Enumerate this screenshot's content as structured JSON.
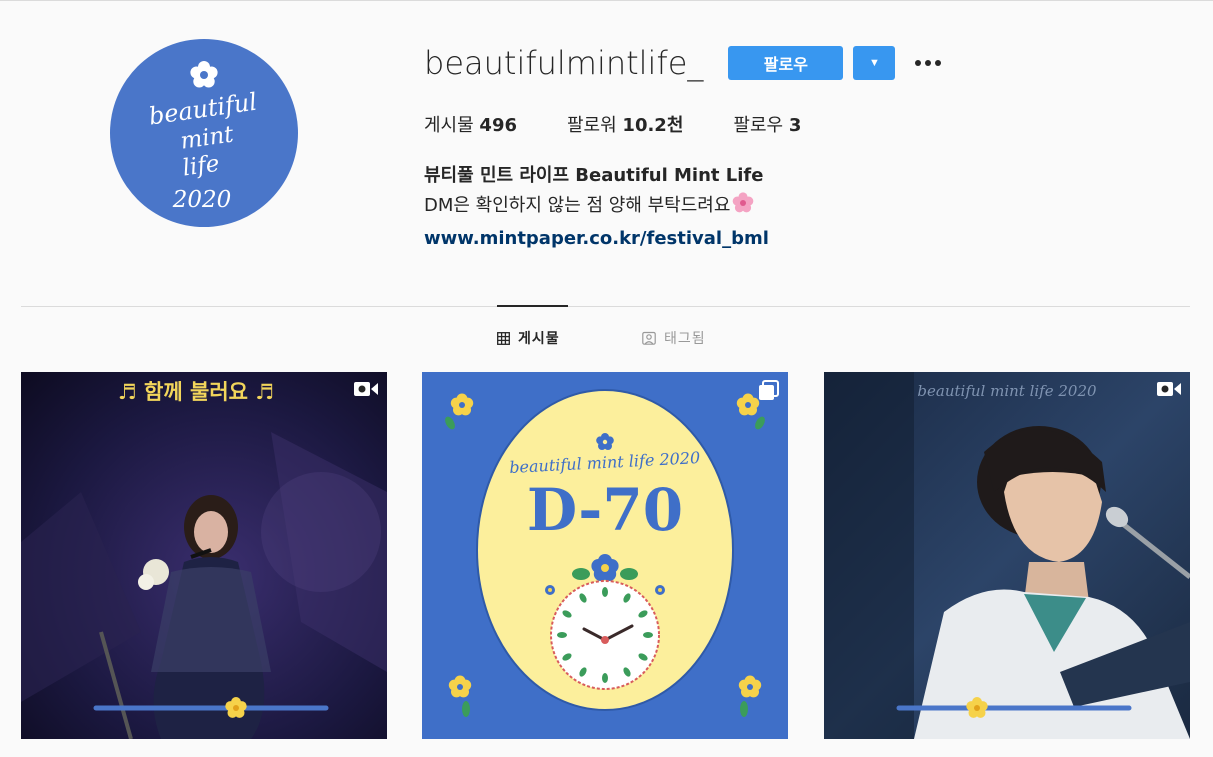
{
  "profile": {
    "username": "beautifulmintlife_",
    "follow_label": "팔로우",
    "dropdown_label": "▼",
    "avatar_text": [
      "beautiful",
      "mint",
      "life",
      "2020"
    ],
    "stats": {
      "posts_label": "게시물",
      "posts_value": "496",
      "followers_label": "팔로워",
      "followers_value": "10.2천",
      "following_label": "팔로우",
      "following_value": "3"
    },
    "bio": {
      "name": "뷰티풀 민트 라이프 Beautiful Mint Life",
      "text": "DM은 확인하지 않는 점 양해 부탁드려요",
      "link": "www.mintpaper.co.kr/festival_bml"
    }
  },
  "tabs": {
    "posts": "게시물",
    "tagged": "태그됨"
  },
  "posts": [
    {
      "overlay_text": "♬ 함께 불러요 ♬",
      "media_type": "video"
    },
    {
      "title": "beautiful mint life 2020",
      "countdown": "D-70",
      "media_type": "carousel"
    },
    {
      "watermark": "beautiful mint life 2020",
      "media_type": "video"
    }
  ],
  "colors": {
    "accent": "#3897f0",
    "avatar_bg": "#4a76c9",
    "link": "#003569",
    "poster_blue": "#3f6fc8",
    "poster_yellow": "#fcef9c"
  }
}
